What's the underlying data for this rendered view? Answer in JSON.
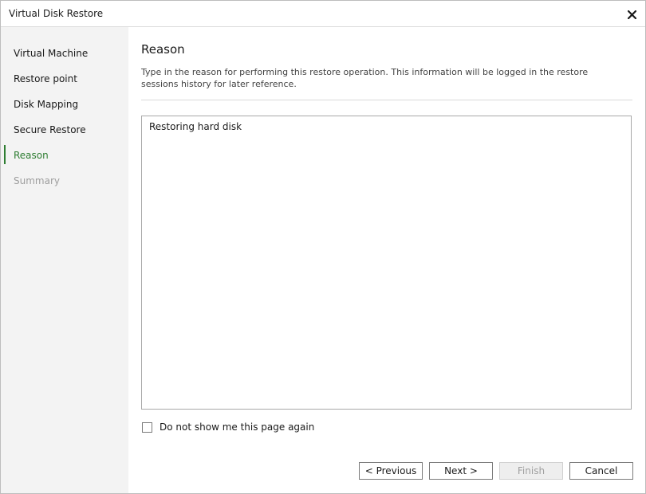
{
  "window": {
    "title": "Virtual Disk Restore"
  },
  "sidebar": {
    "steps": [
      {
        "label": "Virtual Machine",
        "state": "completed"
      },
      {
        "label": "Restore point",
        "state": "completed"
      },
      {
        "label": "Disk Mapping",
        "state": "completed"
      },
      {
        "label": "Secure Restore",
        "state": "completed"
      },
      {
        "label": "Reason",
        "state": "active"
      },
      {
        "label": "Summary",
        "state": "disabled"
      }
    ]
  },
  "main": {
    "heading": "Reason",
    "description": "Type in the reason for performing this restore operation. This information will be logged in the restore sessions history for later reference.",
    "reason_value": "Restoring hard disk",
    "checkbox": {
      "label": "Do not show me this page again",
      "checked": false
    }
  },
  "buttons": {
    "previous": "< Previous",
    "next": "Next >",
    "finish": "Finish",
    "cancel": "Cancel"
  },
  "colors": {
    "accent": "#2e7d32",
    "sidebar_bg": "#f3f3f3",
    "disabled_text": "#9e9e9e"
  },
  "icons": {
    "close": "close-icon"
  }
}
